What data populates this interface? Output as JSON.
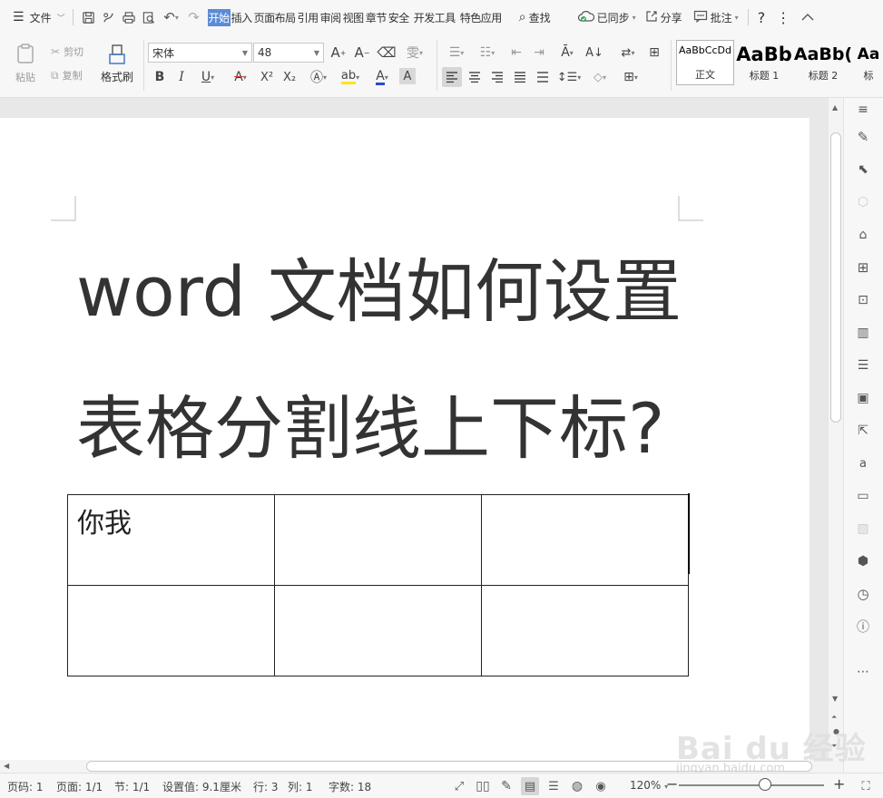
{
  "menubar": {
    "file_label": "文件",
    "tabs": [
      {
        "label": "开始",
        "active": true
      },
      {
        "label": "插入"
      },
      {
        "label": "页面布局"
      },
      {
        "label": "引用"
      },
      {
        "label": "审阅"
      },
      {
        "label": "视图"
      },
      {
        "label": "章节"
      },
      {
        "label": "安全"
      },
      {
        "label": "开发工具"
      },
      {
        "label": "特色应用"
      }
    ],
    "search_label": "查找",
    "sync_label": "已同步",
    "share_label": "分享",
    "comment_label": "批注",
    "help_label": "?"
  },
  "ribbon": {
    "paste_label": "粘贴",
    "cut_label": "剪切",
    "copy_label": "复制",
    "format_painter_label": "格式刷",
    "font_name": "宋体",
    "font_size": "48",
    "bold_label": "B",
    "italic_label": "I",
    "underline_label": "U",
    "superscript_label": "X²",
    "subscript_label": "X₂",
    "styles": [
      {
        "preview": "AaBbCcDd",
        "caption": "正文",
        "selected": true
      },
      {
        "preview": "AaBb",
        "caption": "标题 1"
      },
      {
        "preview": "AaBb(",
        "caption": "标题 2"
      },
      {
        "preview": "Aa",
        "caption": "标"
      }
    ]
  },
  "document": {
    "title_line1": "word 文档如何设置",
    "title_line2": "表格分割线上下标?",
    "table": [
      [
        "你我",
        "",
        ""
      ],
      [
        "",
        "",
        ""
      ]
    ]
  },
  "statusbar": {
    "page_num": "页码: 1",
    "page_count": "页面: 1/1",
    "section": "节: 1/1",
    "setting": "设置值: 9.1厘米",
    "row": "行: 3",
    "col": "列: 1",
    "word_count": "字数: 18",
    "zoom": "120%",
    "zoom_level_percent": 120
  },
  "watermark": {
    "text": "Bai du 经验",
    "url": "jingyan.baidu.com"
  },
  "colors": {
    "active_tab": "#5b8bd6",
    "sync_green": "#3aa655",
    "page_bg": "#e8e8e8"
  }
}
